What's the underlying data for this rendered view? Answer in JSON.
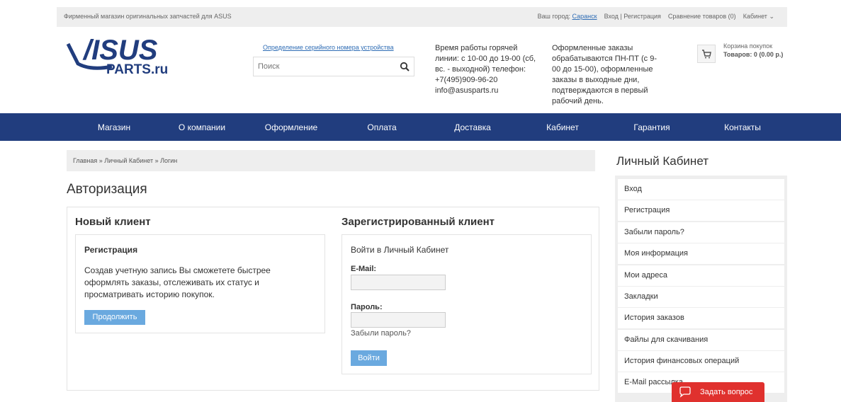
{
  "topbar": {
    "shop_text": "Фирменный магазин оригинальных запчастей для ASUS",
    "city_label": "Ваш город:",
    "city_value": "Саранск",
    "login_text": "Вход | Регистрация",
    "compare_text": "Сравнение товаров (0)",
    "cabinet_text": "Кабинет"
  },
  "header": {
    "logo_text": "/ISUS",
    "logo_sub": "PARTS.ru",
    "serial_link": "Определение серийного номера устройства",
    "search_placeholder": "Поиск",
    "hours_text": "Время работы горячей линии: с 10-00 до 19-00 (сб, вс. - выходной) телефон: +7(495)909-96-20 info@asusparts.ru",
    "orders_text": "Оформленные заказы обрабатываются ПН-ПТ (с 9-00 до 15-00), оформленные заказы в выходные дни, подтверждаются в первый рабочий день.",
    "cart_label": "Корзина покупок",
    "cart_total": "Товаров: 0 (0.00 р.)"
  },
  "nav": {
    "items": [
      "Магазин",
      "О компании",
      "Оформление",
      "Оплата",
      "Доставка",
      "Кабинет",
      "Гарантия",
      "Контакты"
    ]
  },
  "breadcrumb": "Главная » Личный Кабинет » Логин",
  "page_title": "Авторизация",
  "new_client": {
    "title": "Новый клиент",
    "reg_title": "Регистрация",
    "text": "Создав учетную запись Вы сможетете быстрее оформлять заказы, отслеживать их статус и просматривать историю покупок.",
    "button": "Продолжить"
  },
  "registered_client": {
    "title": "Зарегистрированный клиент",
    "subtitle": "Войти в Личный Кабинет",
    "email_label": "E-Mail:",
    "password_label": "Пароль:",
    "forgot": "Забыли пароль?",
    "button": "Войти"
  },
  "sidebar": {
    "title": "Личный Кабинет",
    "items": [
      "Вход",
      "Регистрация",
      "Забыли пароль?",
      "Моя информация",
      "Мои адреса",
      "Закладки",
      "История заказов",
      "Файлы для скачивания",
      "История финансовых операций",
      "E-Mail рассылка"
    ]
  },
  "ask_button": "Задать вопрос",
  "colors": {
    "nav_bg": "#213d7e",
    "button_blue": "#6aa9df",
    "ask_red": "#e0312e",
    "link_blue": "#2f6db5"
  }
}
